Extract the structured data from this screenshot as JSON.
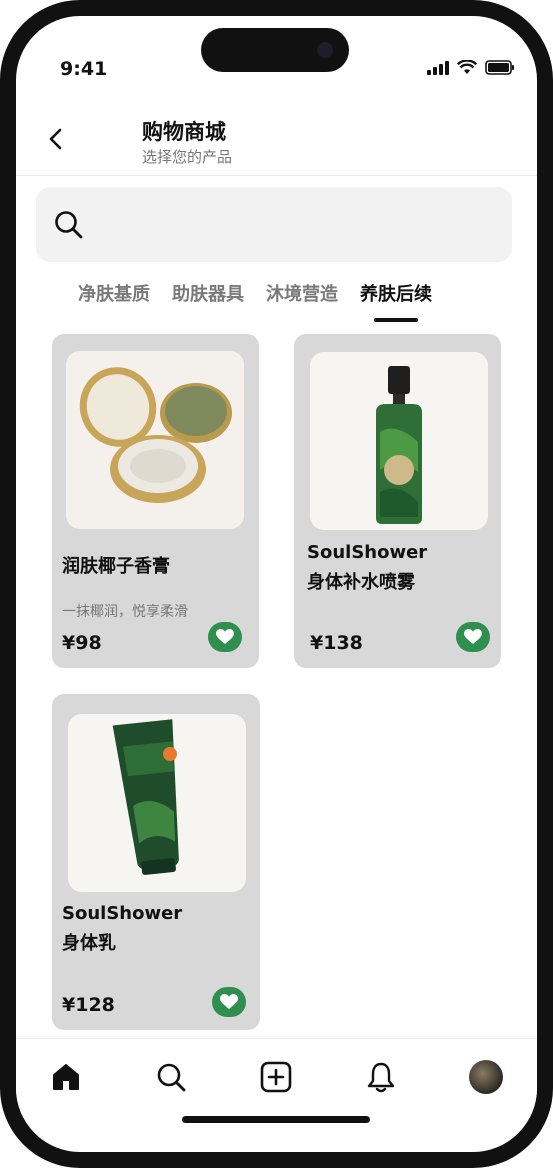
{
  "status": {
    "time": "9:41"
  },
  "header": {
    "title": "购物商城",
    "subtitle": "选择您的产品"
  },
  "search": {
    "placeholder": ""
  },
  "tabs": [
    {
      "label": "净肤基质"
    },
    {
      "label": "助肤器具"
    },
    {
      "label": "沐境营造"
    },
    {
      "label": "养肤后续",
      "active": true
    }
  ],
  "products": [
    {
      "name": "润肤椰子香膏",
      "desc": "一抹椰润，悦享柔滑",
      "price": "¥98",
      "image": "compact-balm-image",
      "favorite": true
    },
    {
      "name": "SoulShower\n身体补水喷雾",
      "price": "¥138",
      "image": "spray-bottle-image",
      "favorite": true
    },
    {
      "name": "SoulShower\n身体乳",
      "price": "¥128",
      "image": "lotion-tube-image",
      "favorite": true
    }
  ],
  "nav": [
    {
      "icon": "home-icon"
    },
    {
      "icon": "search-icon"
    },
    {
      "icon": "add-icon"
    },
    {
      "icon": "bell-icon"
    },
    {
      "icon": "avatar"
    }
  ],
  "colors": {
    "accent": "#2f8f4e",
    "card_bg": "#d8d8d8",
    "search_bg": "#f2f2f2"
  }
}
